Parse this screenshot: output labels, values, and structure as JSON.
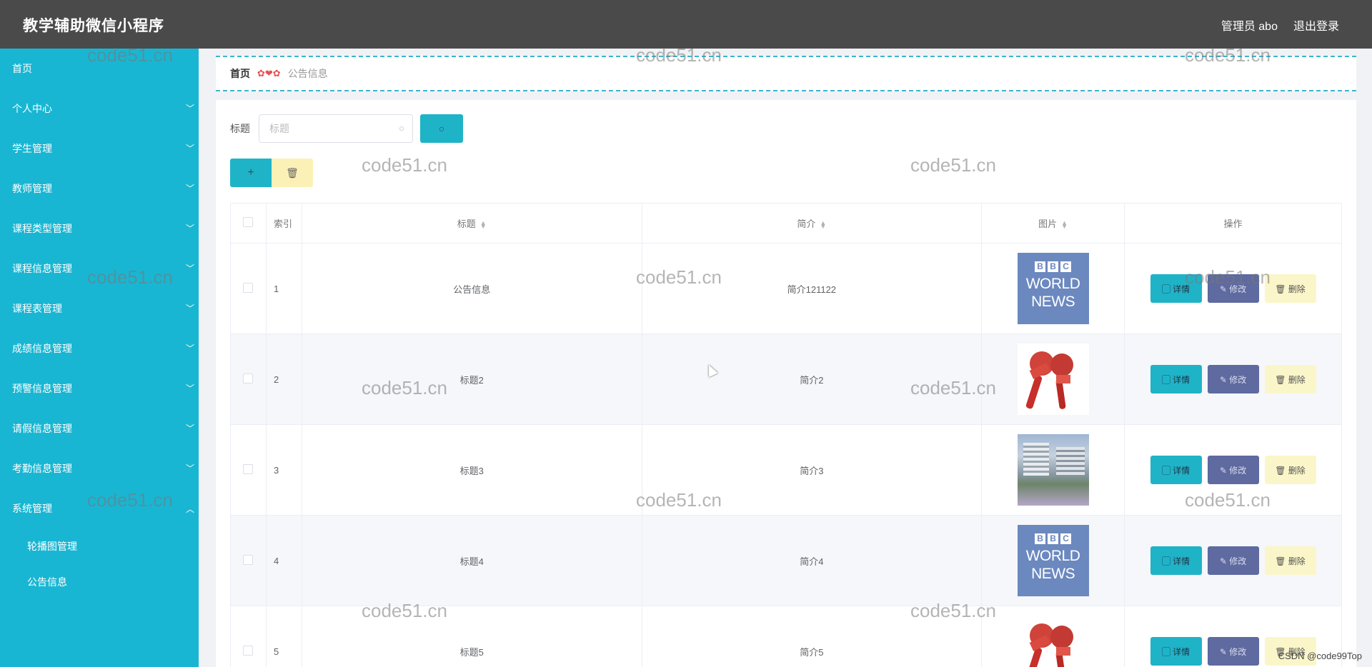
{
  "header": {
    "title": "教学辅助微信小程序",
    "user_label": "管理员 abo",
    "logout_label": "退出登录"
  },
  "sidebar": {
    "items": [
      {
        "label": "首页"
      },
      {
        "label": "个人中心"
      },
      {
        "label": "学生管理"
      },
      {
        "label": "教师管理"
      },
      {
        "label": "课程类型管理"
      },
      {
        "label": "课程信息管理"
      },
      {
        "label": "课程表管理"
      },
      {
        "label": "成绩信息管理"
      },
      {
        "label": "预警信息管理"
      },
      {
        "label": "请假信息管理"
      },
      {
        "label": "考勤信息管理"
      },
      {
        "label": "系统管理"
      }
    ],
    "sub_items": [
      {
        "label": "轮播图管理"
      },
      {
        "label": "公告信息"
      }
    ]
  },
  "breadcrumb": {
    "home": "首页",
    "separator": "✿❤✿",
    "current": "公告信息"
  },
  "search": {
    "label": "标题",
    "placeholder": "标题",
    "value": ""
  },
  "table": {
    "headers": {
      "index": "索引",
      "title": "标题",
      "intro": "简介",
      "image": "图片",
      "actions": "操作"
    },
    "rows": [
      {
        "index": "1",
        "title": "公告信息",
        "intro": "简介121122",
        "image": "bbc-world-news"
      },
      {
        "index": "2",
        "title": "标题2",
        "intro": "简介2",
        "image": "news-microphones"
      },
      {
        "index": "3",
        "title": "标题3",
        "intro": "简介3",
        "image": "campus-photo"
      },
      {
        "index": "4",
        "title": "标题4",
        "intro": "简介4",
        "image": "bbc-world-news"
      },
      {
        "index": "5",
        "title": "标题5",
        "intro": "简介5",
        "image": "news-microphones"
      }
    ],
    "actions": {
      "detail": "详情",
      "edit": "修改",
      "delete": "删除"
    }
  },
  "bbc_logo": {
    "letters": [
      "B",
      "B",
      "C"
    ],
    "line1": "WORLD",
    "line2": "NEWS"
  },
  "watermark": "code51.cn",
  "footer_mark": "CSDN @code99Top",
  "colors": {
    "header_bg": "#4a4a4a",
    "sidebar_bg": "#19b6d3",
    "primary": "#1fb3c8",
    "edit": "#5e6aa0",
    "delete": "#fbf6c9"
  }
}
